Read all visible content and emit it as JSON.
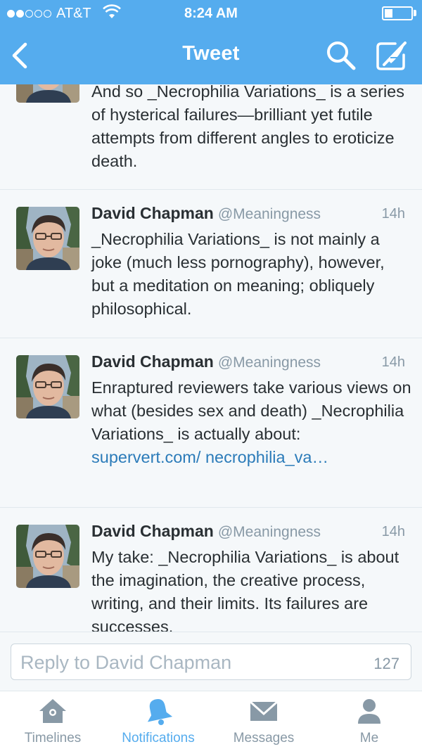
{
  "status_bar": {
    "carrier": "AT&T",
    "time": "8:24 AM",
    "signal_bars_filled": 2,
    "signal_bars_total": 5,
    "battery_level": 0.3
  },
  "nav": {
    "title": "Tweet",
    "back_icon": "chevron-left-icon",
    "search_icon": "search-icon",
    "compose_icon": "compose-icon"
  },
  "tweets": [
    {
      "name": "",
      "handle": "",
      "time": "",
      "text": "And so _Necrophilia Variations_ is a series of hysterical failures—brilliant yet futile attempts from different angles to eroticize death."
    },
    {
      "name": "David Chapman",
      "handle": "@Meaningness",
      "time": "14h",
      "text": "_Necrophilia Variations_ is not mainly a joke (much less pornography), however, but a meditation on meaning; obliquely philosophical."
    },
    {
      "name": "David Chapman",
      "handle": "@Meaningness",
      "time": "14h",
      "text": "Enraptured reviewers take various views on what (besides sex and death) _Necrophilia Variations_ is actually about: ",
      "link": "supervert.com/ necrophilia_va…"
    },
    {
      "name": "David Chapman",
      "handle": "@Meaningness",
      "time": "14h",
      "text": "My take: _Necrophilia Variations_ is about the imagination, the creative process, writing, and their limits. Its failures are successes."
    }
  ],
  "reply": {
    "placeholder": "Reply to David Chapman",
    "char_count": "127"
  },
  "tabs": [
    {
      "label": "Timelines",
      "icon": "home-icon",
      "active": false
    },
    {
      "label": "Notifications",
      "icon": "bell-icon",
      "active": true
    },
    {
      "label": "Messages",
      "icon": "envelope-icon",
      "active": false
    },
    {
      "label": "Me",
      "icon": "person-icon",
      "active": false
    }
  ],
  "colors": {
    "brand_blue": "#55acee",
    "link": "#2b7bb9",
    "muted": "#8899a6",
    "text": "#292f33"
  }
}
